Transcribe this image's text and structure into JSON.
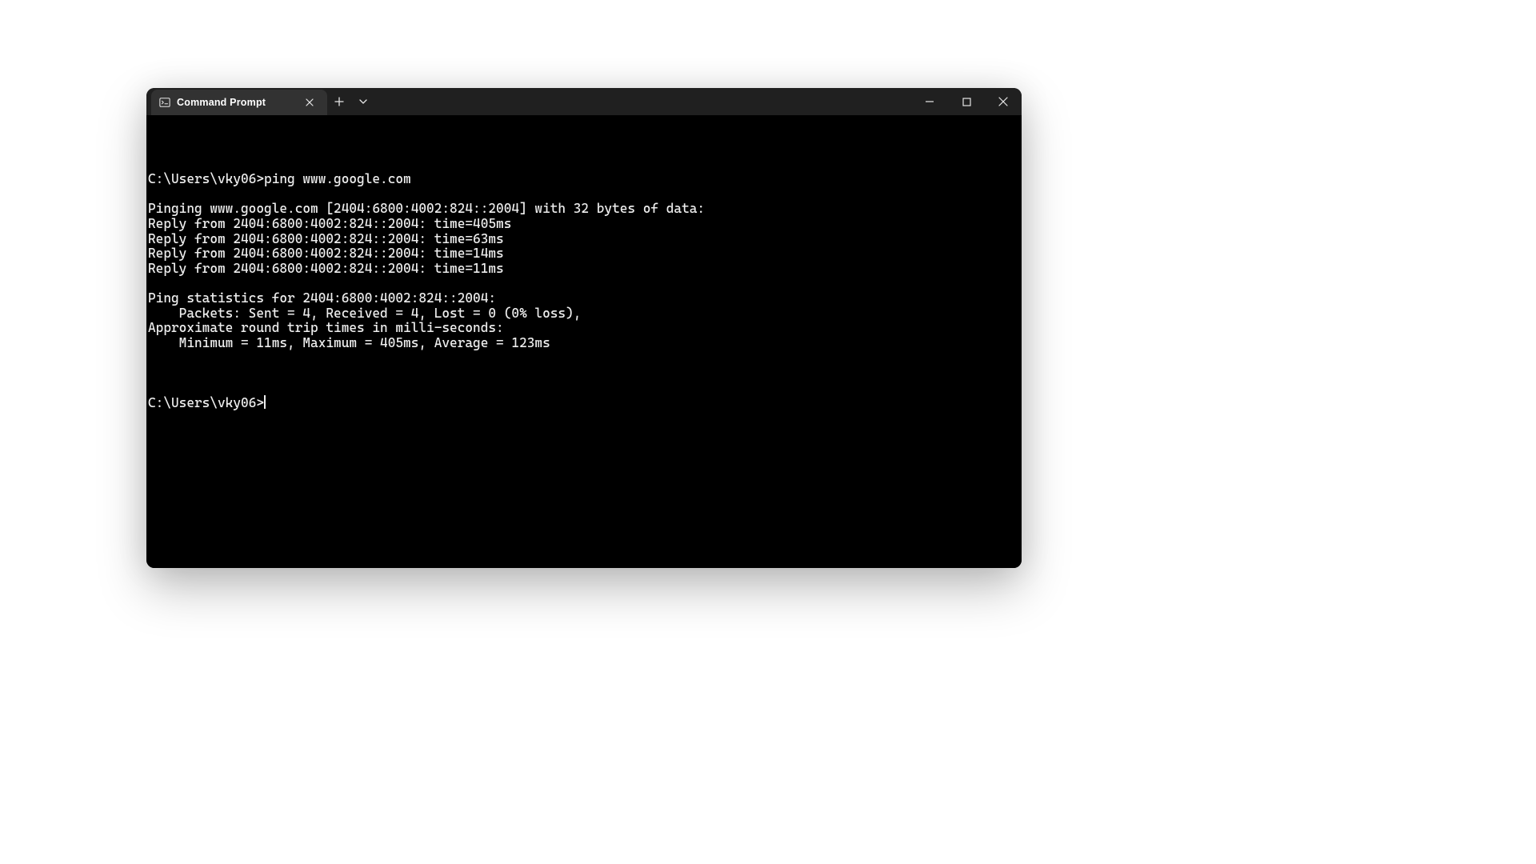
{
  "tab": {
    "title": "Command Prompt"
  },
  "terminal": {
    "lines": [
      "C:\\Users\\vky06>ping www.google.com",
      "",
      "Pinging www.google.com [2404:6800:4002:824::2004] with 32 bytes of data:",
      "Reply from 2404:6800:4002:824::2004: time=405ms",
      "Reply from 2404:6800:4002:824::2004: time=63ms",
      "Reply from 2404:6800:4002:824::2004: time=14ms",
      "Reply from 2404:6800:4002:824::2004: time=11ms",
      "",
      "Ping statistics for 2404:6800:4002:824::2004:",
      "    Packets: Sent = 4, Received = 4, Lost = 0 (0% loss),",
      "Approximate round trip times in milli-seconds:",
      "    Minimum = 11ms, Maximum = 405ms, Average = 123ms",
      ""
    ],
    "prompt": "C:\\Users\\vky06>"
  }
}
